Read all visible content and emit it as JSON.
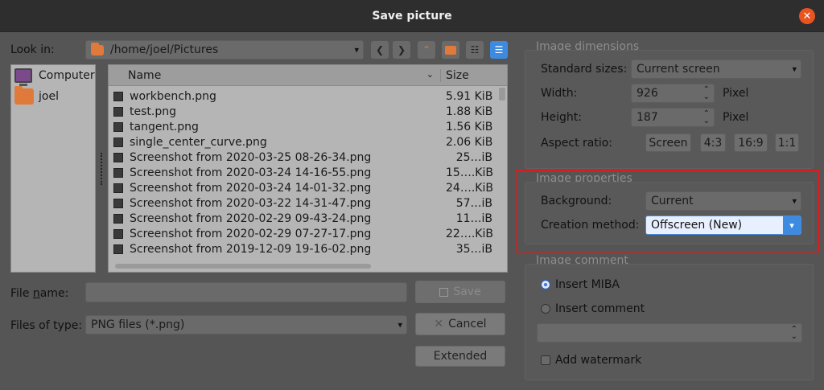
{
  "window": {
    "title": "Save picture",
    "close_glyph": "✕"
  },
  "look_in": {
    "label": "Look in:",
    "path": "/home/joel/Pictures"
  },
  "places": [
    {
      "label": "Computer",
      "icon": "computer-icon"
    },
    {
      "label": "joel",
      "icon": "folder-icon"
    }
  ],
  "file_list": {
    "col_name": "Name",
    "col_size": "Size",
    "rows": [
      {
        "name": "workbench.png",
        "size": "5.91 KiB"
      },
      {
        "name": "test.png",
        "size": "1.88 KiB"
      },
      {
        "name": "tangent.png",
        "size": "1.56 KiB"
      },
      {
        "name": "single_center_curve.png",
        "size": "2.06 KiB"
      },
      {
        "name": "Screenshot from 2020-03-25 08-26-34.png",
        "size": "25…iB"
      },
      {
        "name": "Screenshot from 2020-03-24 14-16-55.png",
        "size": "15….KiB"
      },
      {
        "name": "Screenshot from 2020-03-24 14-01-32.png",
        "size": "24….KiB"
      },
      {
        "name": "Screenshot from 2020-03-22 14-31-47.png",
        "size": "57…iB"
      },
      {
        "name": "Screenshot from 2020-02-29 09-43-24.png",
        "size": "11…iB"
      },
      {
        "name": "Screenshot from 2020-02-29 07-27-17.png",
        "size": "22….KiB"
      },
      {
        "name": "Screenshot from 2019-12-09 19-16-02.png",
        "size": "35…iB"
      }
    ]
  },
  "file_name": {
    "label_pre": "File ",
    "label_u": "n",
    "label_post": "ame:",
    "value": ""
  },
  "file_type": {
    "label": "Files of type:",
    "value": "PNG files (*.png)"
  },
  "buttons": {
    "save": "Save",
    "cancel": "Cancel",
    "extended": "Extended"
  },
  "image_dimensions": {
    "title": "Image dimensions",
    "standard_sizes_label": "Standard sizes:",
    "standard_sizes_value": "Current screen",
    "width_label": "Width:",
    "width_value": "926",
    "height_label": "Height:",
    "height_value": "187",
    "unit": "Pixel",
    "aspect_label": "Aspect ratio:",
    "aspect_buttons": [
      "Screen",
      "4:3",
      "16:9",
      "1:1"
    ]
  },
  "image_properties": {
    "title": "Image properties",
    "background_label": "Background:",
    "background_value": "Current",
    "creation_label": "Creation method:",
    "creation_value": "Offscreen (New)"
  },
  "image_comment": {
    "title": "Image comment",
    "insert_miba": "Insert MIBA",
    "insert_comment": "Insert comment",
    "add_watermark": "Add watermark",
    "comment_value": ""
  },
  "colors": {
    "accent": "#3d8be0",
    "close": "#e95420",
    "highlight": "#d31f1f"
  }
}
